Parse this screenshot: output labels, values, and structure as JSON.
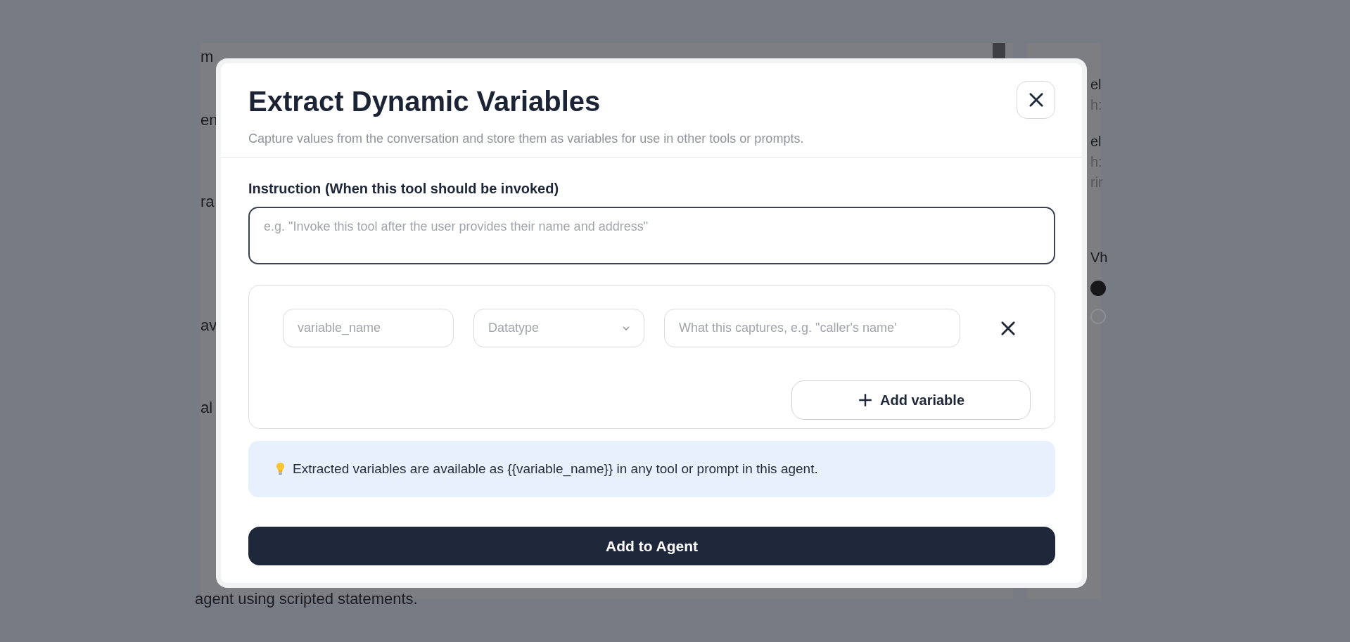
{
  "background": {
    "left_fragments": [
      "m",
      "en",
      "ra",
      "av",
      "al"
    ],
    "footer_text": "agent using scripted statements.",
    "right_fragments": [
      {
        "text": "el",
        "kind": "title"
      },
      {
        "text": "h:",
        "kind": "sub"
      },
      {
        "text": "el",
        "kind": "title"
      },
      {
        "text": "h:",
        "kind": "sub"
      },
      {
        "text": "rir",
        "kind": "sub"
      },
      {
        "text": "Vh",
        "kind": "title"
      }
    ],
    "options": [
      {
        "selected": true
      },
      {
        "selected": false
      }
    ]
  },
  "modal": {
    "title": "Extract Dynamic Variables",
    "subtitle": "Capture values from the conversation and store them as variables for use in other tools or prompts.",
    "instruction": {
      "label": "Instruction (When this tool should be invoked)",
      "placeholder": "e.g. \"Invoke this tool after the user provides their name and address\""
    },
    "variables": [
      {
        "name_placeholder": "variable_name",
        "datatype_placeholder": "Datatype",
        "description_placeholder": "What this captures, e.g. \"caller's name'"
      }
    ],
    "add_variable_button": "Add variable",
    "info": "Extracted variables are available as {{variable_name}} in any tool or prompt in this agent.",
    "submit_button": "Add to Agent"
  }
}
